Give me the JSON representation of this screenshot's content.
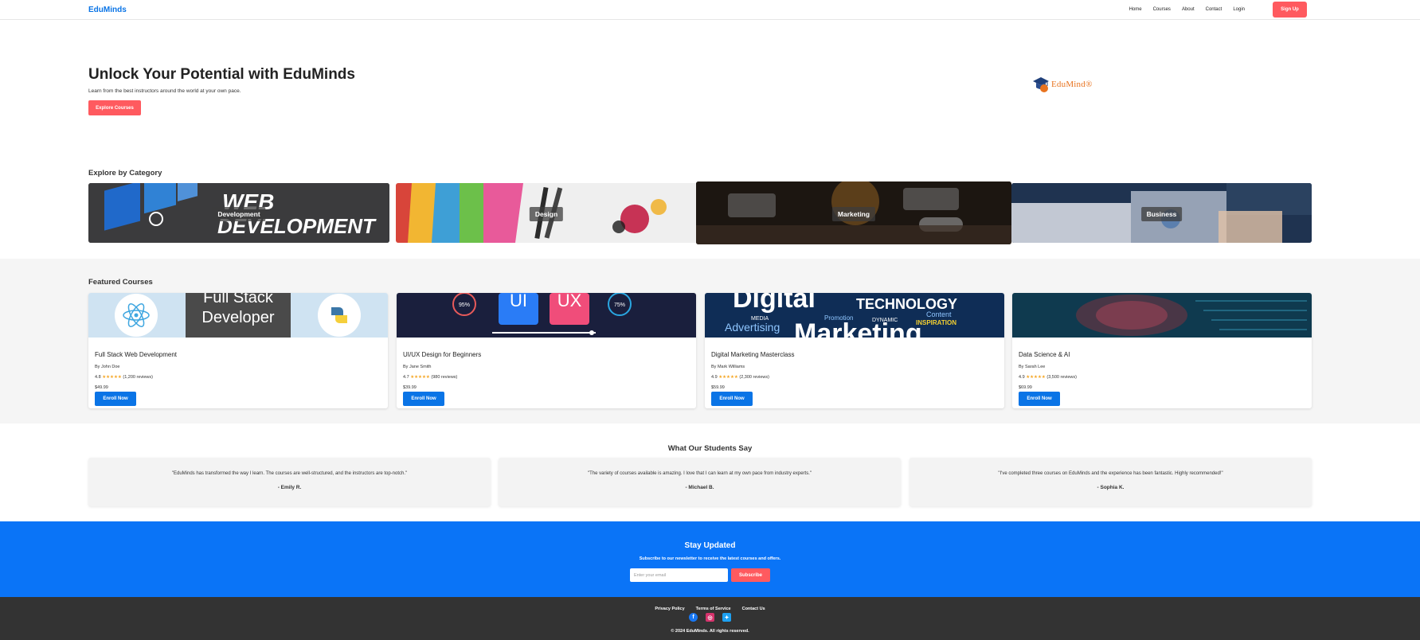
{
  "nav": {
    "brand": "EduMinds",
    "links": [
      "Home",
      "Courses",
      "About",
      "Contact",
      "Login"
    ],
    "signup_label": "Sign Up"
  },
  "hero": {
    "title": "Unlock Your Potential with EduMinds",
    "subtitle": "Learn from the best instructors around the world at your own pace.",
    "cta_label": "Explore Courses",
    "logo_text": "EduMind®"
  },
  "categories": {
    "title": "Explore by Category",
    "image_text_web": "WEB",
    "image_text_dev": "DEVELOPMENT",
    "items": [
      {
        "label": "Development"
      },
      {
        "label": "Design"
      },
      {
        "label": "Marketing"
      },
      {
        "label": "Business"
      }
    ]
  },
  "featured": {
    "title": "Featured Courses",
    "enroll_label": "Enroll Now",
    "image_texts": {
      "fullstack_1": "Full Stack",
      "fullstack_2": "Developer",
      "ui": "UI",
      "ux": "UX",
      "pct1": "95%",
      "pct2": "75%",
      "digital": "Digital",
      "technology": "TECHNOLOGY",
      "content": "Content",
      "inspiration": "INSPIRATION",
      "dynamic": "DYNAMIC",
      "promotion": "Promotion",
      "media": "MEDIA",
      "advertising": "Advertising",
      "marketing": "Marketing"
    },
    "courses": [
      {
        "title": "Full Stack Web Development",
        "author": "By John Doe",
        "rating": "4.8",
        "reviews": "(1,200 reviews)",
        "price": "$49.99"
      },
      {
        "title": "UI/UX Design for Beginners",
        "author": "By Jane Smith",
        "rating": "4.7",
        "reviews": "(980 reviews)",
        "price": "$39.99"
      },
      {
        "title": "Digital Marketing Masterclass",
        "author": "By Mark Williams",
        "rating": "4.9",
        "reviews": "(2,300 reviews)",
        "price": "$59.99"
      },
      {
        "title": "Data Science & AI",
        "author": "By Sarah Lee",
        "rating": "4.9",
        "reviews": "(3,500 reviews)",
        "price": "$69.99"
      }
    ],
    "stars": "★★★★★"
  },
  "testimonials": {
    "title": "What Our Students Say",
    "items": [
      {
        "quote": "\"EduMinds has transformed the way I learn. The courses are well-structured, and the instructors are top-notch.\"",
        "author": "- Emily R."
      },
      {
        "quote": "\"The variety of courses available is amazing. I love that I can learn at my own pace from industry experts.\"",
        "author": "- Michael B."
      },
      {
        "quote": "\"I've completed three courses on EduMinds and the experience has been fantastic. Highly recommended!\"",
        "author": "- Sophia K."
      }
    ]
  },
  "newsletter": {
    "title": "Stay Updated",
    "subtitle": "Subscribe to our newsletter to receive the latest courses and offers.",
    "placeholder": "Enter your email",
    "button_label": "Subscribe"
  },
  "footer": {
    "links": [
      "Privacy Policy",
      "Terms of Service",
      "Contact Us"
    ],
    "social": [
      "facebook-icon",
      "instagram-icon",
      "twitter-icon"
    ],
    "copyright": "© 2024 EduMinds. All rights reserved."
  },
  "colors": {
    "brand": "#0a74e6",
    "accent": "#ff5a5f",
    "newsletter_bg": "#0a74f7",
    "footer_bg": "#333333",
    "star": "#f5a623"
  }
}
